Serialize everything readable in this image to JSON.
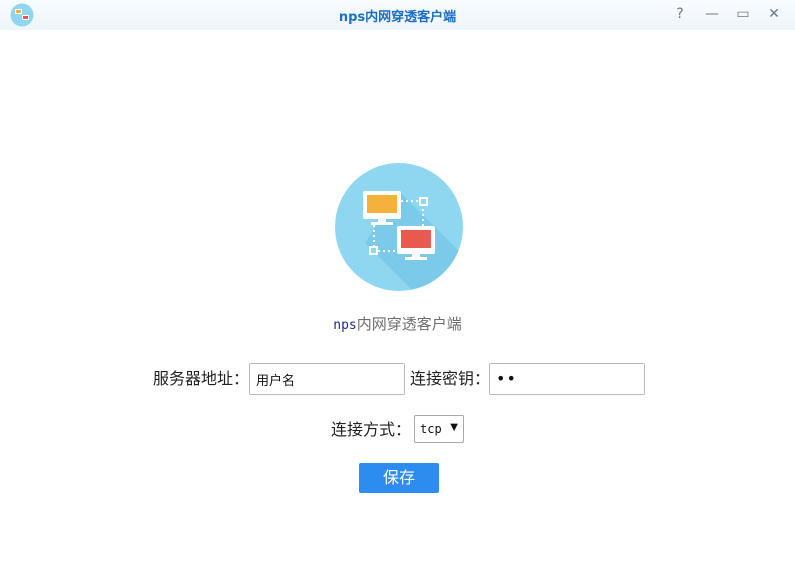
{
  "window": {
    "title": "nps内网穿透客户端"
  },
  "titlebar_buttons": {
    "help": "?",
    "minimize": "—",
    "maximize": "▭",
    "close": "✕"
  },
  "header": {
    "subtitle_en": "nps",
    "subtitle_cn": "内网穿透客户端"
  },
  "form": {
    "server_label": "服务器地址：",
    "server_value": "用户名",
    "key_label": "连接密钥：",
    "key_value": "••",
    "type_label": "连接方式：",
    "type_selected": "tcp",
    "save_label": "保存"
  },
  "colors": {
    "accent": "#2d8cf0",
    "title": "#1a6fc4",
    "logo_circle": "#8fd6f1"
  }
}
